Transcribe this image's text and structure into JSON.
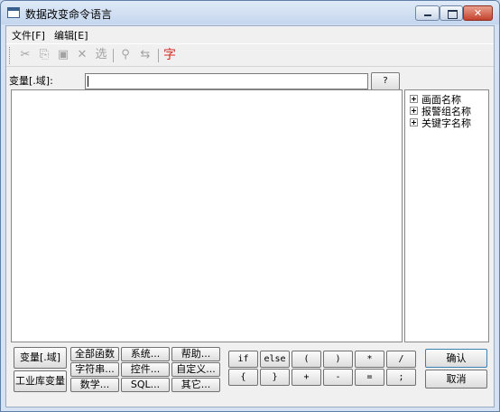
{
  "window": {
    "title": "数据改变命令语言"
  },
  "menubar": {
    "items": [
      "文件[F]",
      "编辑[E]"
    ]
  },
  "toolbar": {
    "cut": "✂",
    "copy": "⎘",
    "paste": "▣",
    "delete": "✕",
    "select": "选",
    "find": "⚲",
    "replace": "⇆",
    "char": "字"
  },
  "variable_row": {
    "label": "变量[.域]:",
    "value": "",
    "browse": "?"
  },
  "tree": {
    "items": [
      "画面名称",
      "报警组名称",
      "关键字名称"
    ]
  },
  "buttons": {
    "var_field": "变量[.域]",
    "db_var": "工业库变量",
    "all_funcs": "全部函数",
    "system": "系统...",
    "help": "帮助...",
    "string": "字符串...",
    "control": "控件...",
    "custom": "自定义...",
    "math": "数学...",
    "sql": "SQL...",
    "other": "其它...",
    "ops_row1": [
      "if",
      "else",
      "(",
      ")",
      "*",
      "/"
    ],
    "ops_row2": [
      "{",
      "}",
      "+",
      "-",
      "=",
      ";"
    ],
    "ok": "确认",
    "cancel": "取消"
  }
}
